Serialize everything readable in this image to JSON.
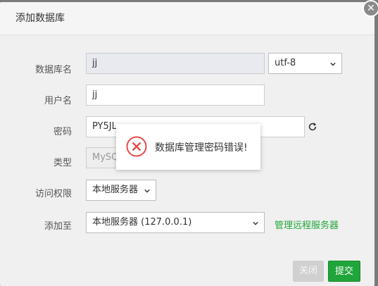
{
  "dialog": {
    "title": "添加数据库",
    "close_glyph": "✕"
  },
  "form": {
    "db_name": {
      "label": "数据库名",
      "value": "jj"
    },
    "charset": {
      "value": "utf-8"
    },
    "username": {
      "label": "用户名",
      "value": "jj"
    },
    "password": {
      "label": "密码",
      "value": "PY5JL"
    },
    "type": {
      "label": "类型",
      "value": "MySQ"
    },
    "access": {
      "label": "访问权限",
      "value": "本地服务器"
    },
    "add_to": {
      "label": "添加至",
      "value": "本地服务器 (127.0.0.1)"
    },
    "manage_remote_link": "管理远程服务器"
  },
  "footer": {
    "close_label": "关闭",
    "submit_label": "提交"
  },
  "alert": {
    "message": "数据库管理密码错误!",
    "icon": "error-circle-icon"
  },
  "colors": {
    "accent_green": "#20a53a",
    "error_red": "#e94a4a",
    "disabled_button": "#d0d0d0"
  }
}
